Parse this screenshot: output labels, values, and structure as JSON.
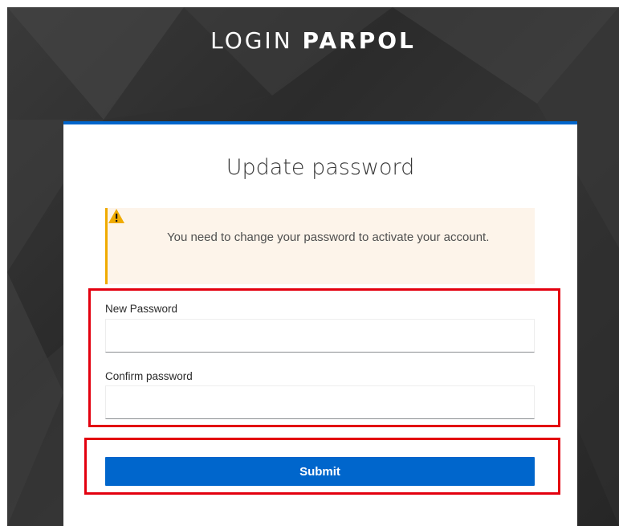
{
  "brand": {
    "prefix": "LOGIN",
    "name": "PARPOL"
  },
  "form": {
    "title": "Update password",
    "alert": {
      "icon": "warning-triangle-icon",
      "message": "You need to change your password to activate your account."
    },
    "new_password": {
      "label": "New Password",
      "value": ""
    },
    "confirm_password": {
      "label": "Confirm password",
      "value": ""
    },
    "submit_label": "Submit"
  },
  "colors": {
    "accent": "#0066cc",
    "alert_border": "#f0ab00",
    "alert_background": "#fdf4ea",
    "highlight": "#e3000f",
    "background_dark": "#2b2b2b"
  }
}
